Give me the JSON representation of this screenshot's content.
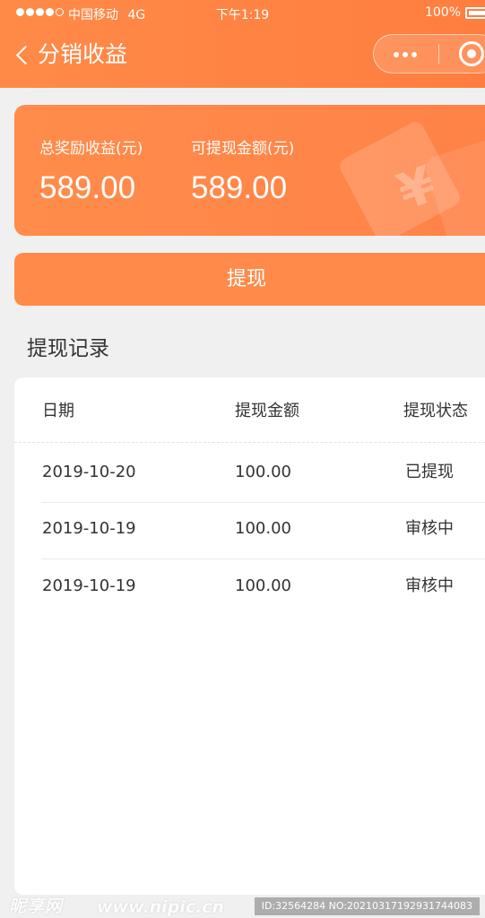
{
  "status_bar": {
    "carrier": "中国移动",
    "network": "4G",
    "time": "下午1:19",
    "battery": "100%"
  },
  "nav": {
    "title": "分销收益",
    "back_icon": "chevron-left-icon",
    "more_icon": "more-dots-icon",
    "close_icon": "target-close-icon"
  },
  "earnings": {
    "total_label": "总奖励收益(元)",
    "total_value": "589.00",
    "withdrawable_label": "可提现金额(元)",
    "withdrawable_value": "589.00",
    "decoration_icon": "yen-coin-icon",
    "decoration_glyph": "¥"
  },
  "withdraw_button": {
    "label": "提现"
  },
  "records": {
    "title": "提现记录",
    "columns": [
      "日期",
      "提现金额",
      "提现状态"
    ],
    "rows": [
      {
        "date": "2019-10-20",
        "amount": "100.00",
        "status": "已提现"
      },
      {
        "date": "2019-10-19",
        "amount": "100.00",
        "status": "审核中"
      },
      {
        "date": "2019-10-19",
        "amount": "100.00",
        "status": "审核中"
      }
    ]
  },
  "watermark": {
    "logo": "昵享网",
    "site": "www.nipic.cn",
    "id": "ID:32564284 NO:20210317192931744083"
  },
  "colors": {
    "brand_orange": "#ff8a49",
    "page_bg": "#f0f0f0",
    "card_bg": "#ffffff",
    "text": "#333333"
  }
}
